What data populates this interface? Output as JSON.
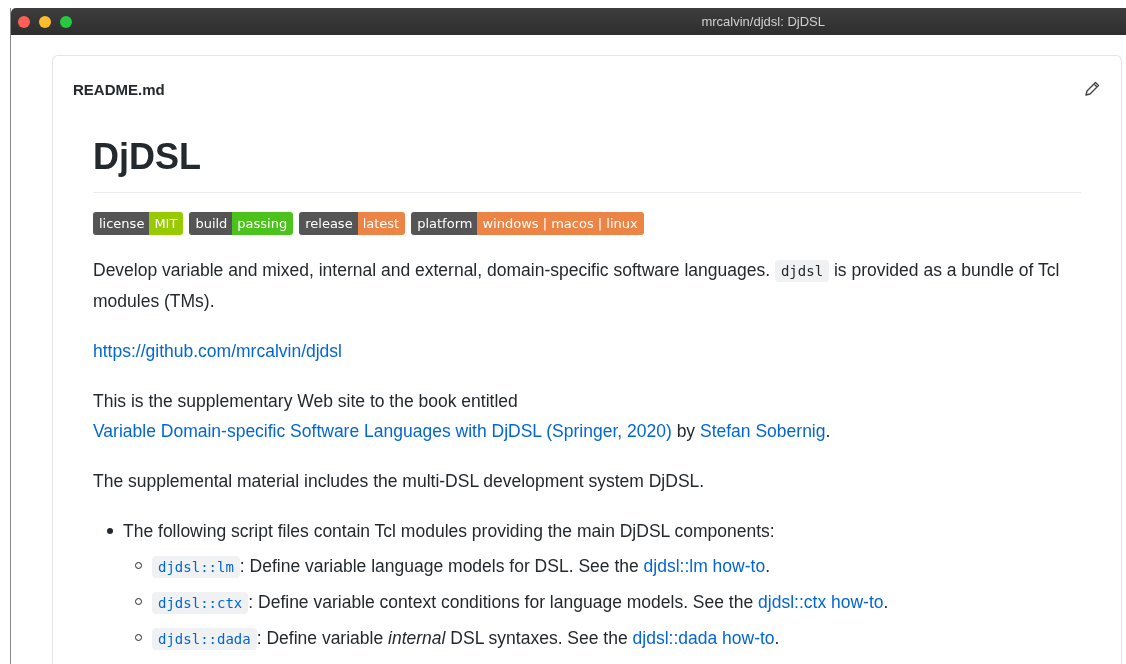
{
  "window": {
    "title": "mrcalvin/djdsl: DjDSL"
  },
  "file_header": {
    "filename": "README.md"
  },
  "readme": {
    "title": "DjDSL",
    "badges": [
      {
        "label": "license",
        "value": "MIT",
        "color": "#97ca00"
      },
      {
        "label": "build",
        "value": "passing",
        "color": "#4cc31c"
      },
      {
        "label": "release",
        "value": "latest",
        "color": "#ec8446"
      },
      {
        "label": "platform",
        "value": "windows | macos | linux",
        "color": "#ec8446"
      }
    ],
    "paragraphs": [
      [
        {
          "kind": "text",
          "text": "Develop variable and mixed, internal and external, domain-specific software languages. "
        },
        {
          "kind": "code",
          "text": "djdsl"
        },
        {
          "kind": "text",
          "text": " is provided as a bundle of Tcl modules (TMs)."
        }
      ],
      [
        {
          "kind": "link",
          "text": "https://github.com/mrcalvin/djdsl"
        }
      ],
      [
        {
          "kind": "text",
          "text": "This is the supplementary Web site to the book entitled "
        },
        {
          "kind": "link",
          "text": "Variable Domain-specific Software Languages with DjDSL (Springer, 2020)"
        },
        {
          "kind": "text",
          "text": " by "
        },
        {
          "kind": "link",
          "text": "Stefan Sobernig"
        },
        {
          "kind": "text",
          "text": "."
        }
      ],
      [
        {
          "kind": "text",
          "text": "The supplemental material includes the multi-DSL development system DjDSL."
        }
      ]
    ],
    "list": [
      {
        "segments": [
          {
            "kind": "text",
            "text": "The following script files contain Tcl modules providing the main DjDSL components:"
          }
        ],
        "children": [
          {
            "segments": [
              {
                "kind": "codelink",
                "text": "djdsl::lm"
              },
              {
                "kind": "text",
                "text": ": Define variable language models for DSL. See the "
              },
              {
                "kind": "link",
                "text": "djdsl::lm how-to"
              },
              {
                "kind": "text",
                "text": "."
              }
            ]
          },
          {
            "segments": [
              {
                "kind": "codelink",
                "text": "djdsl::ctx"
              },
              {
                "kind": "text",
                "text": ": Define variable context conditions for language models. See the "
              },
              {
                "kind": "link",
                "text": "djdsl::ctx how-to"
              },
              {
                "kind": "text",
                "text": "."
              }
            ]
          },
          {
            "segments": [
              {
                "kind": "codelink",
                "text": "djdsl::dada"
              },
              {
                "kind": "text",
                "text": ": Define variable "
              },
              {
                "kind": "em",
                "text": "internal"
              },
              {
                "kind": "text",
                "text": " DSL syntaxes. See the "
              },
              {
                "kind": "link",
                "text": "djdsl::dada how-to"
              },
              {
                "kind": "text",
                "text": "."
              }
            ]
          }
        ]
      }
    ]
  }
}
